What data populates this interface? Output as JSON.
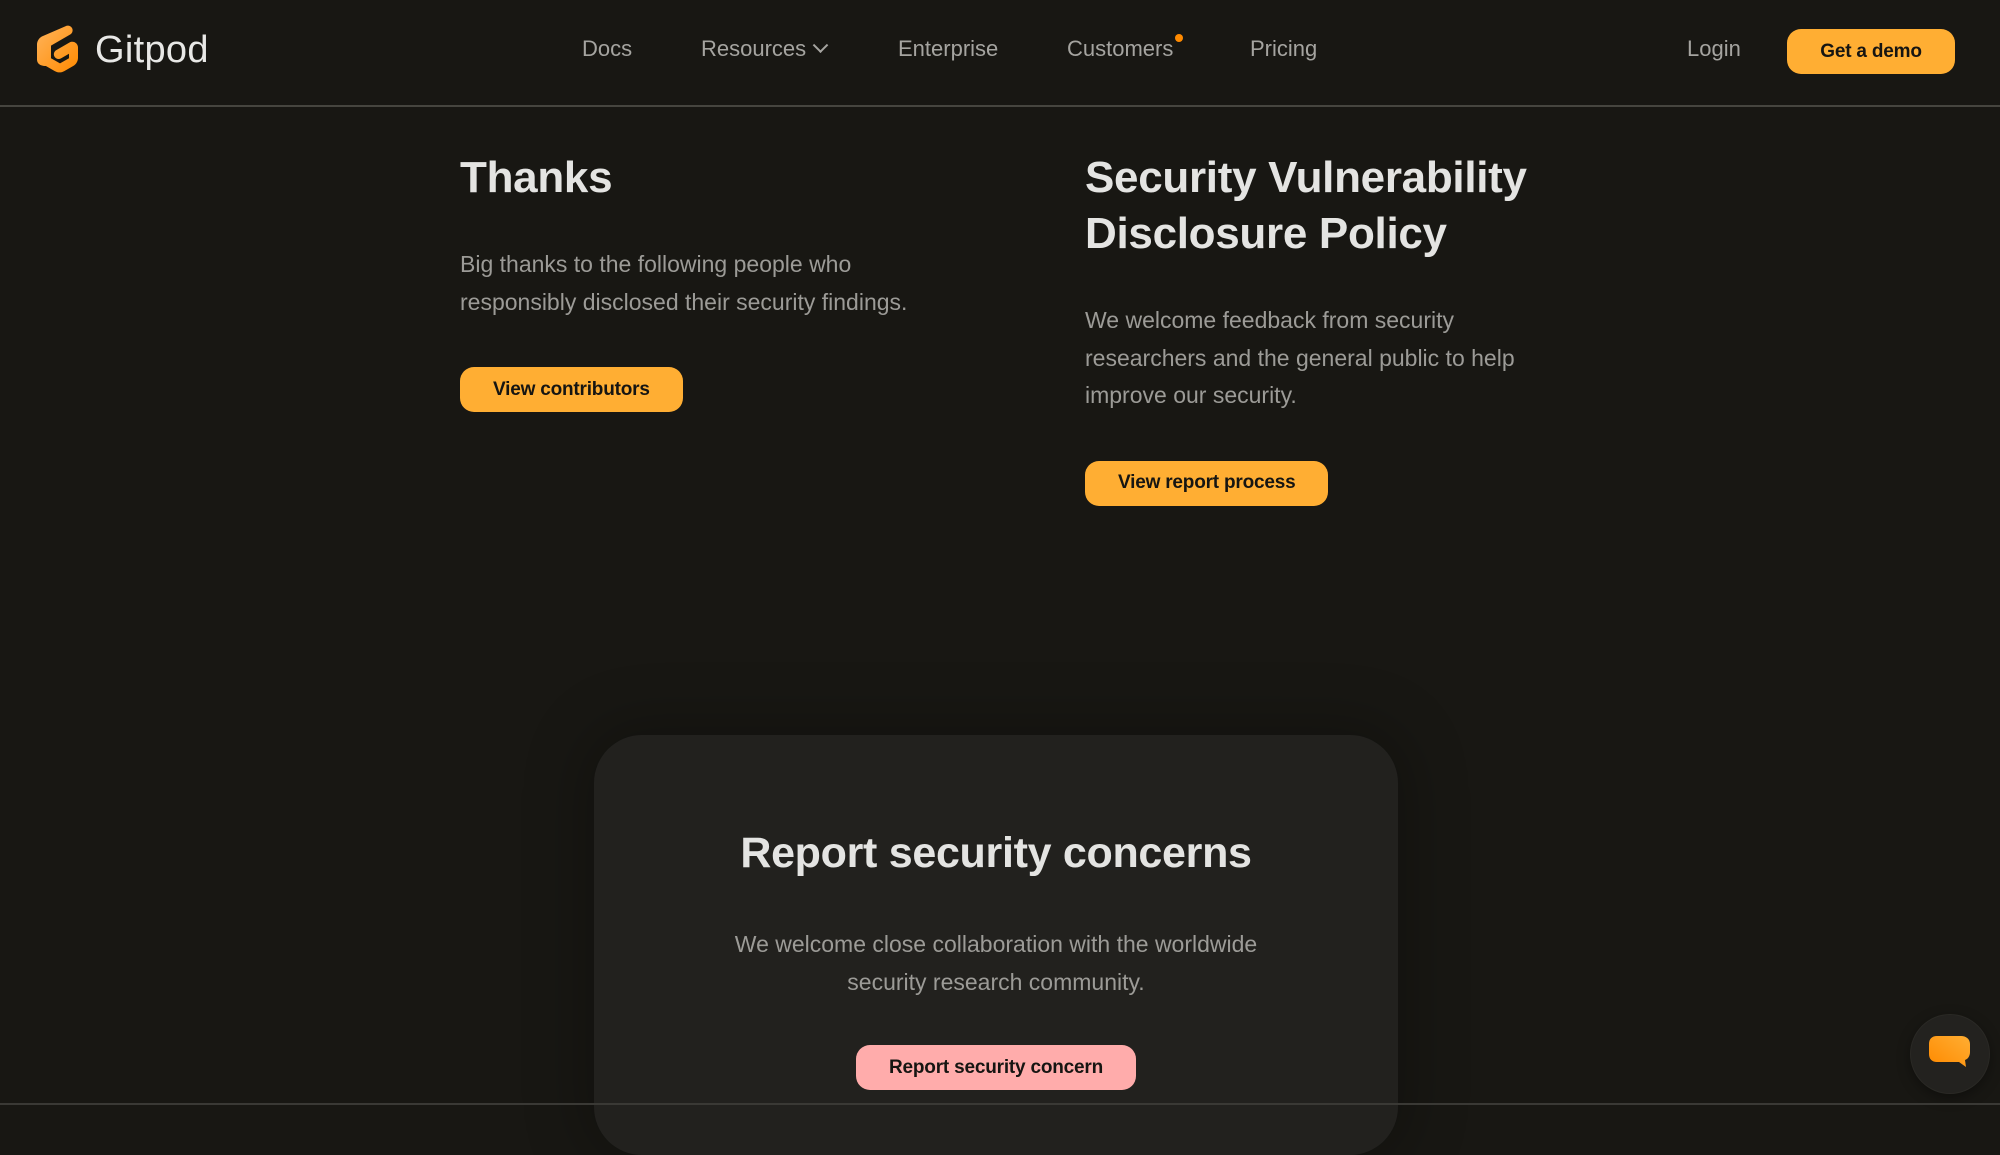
{
  "brand": {
    "name": "Gitpod",
    "accent_color": "#ffae33",
    "logo_icon": "gitpod-logo-icon"
  },
  "nav": {
    "items": [
      {
        "label": "Docs",
        "has_dropdown": false,
        "has_badge": false
      },
      {
        "label": "Resources",
        "has_dropdown": true,
        "has_badge": false
      },
      {
        "label": "Enterprise",
        "has_dropdown": false,
        "has_badge": false
      },
      {
        "label": "Customers",
        "has_dropdown": false,
        "has_badge": true
      },
      {
        "label": "Pricing",
        "has_dropdown": false,
        "has_badge": false
      }
    ],
    "badge_color": "#ff8a00",
    "login_label": "Login",
    "demo_label": "Get a demo"
  },
  "thanks": {
    "title": "Thanks",
    "body": "Big thanks to the following people who responsibly disclosed their security findings.",
    "button_label": "View contributors"
  },
  "policy": {
    "title": "Security Vulnerability Disclosure Policy",
    "body": "We welcome feedback from security researchers and the general public to help improve our security.",
    "button_label": "View report process"
  },
  "report": {
    "title": "Report security concerns",
    "body": "We welcome close collaboration with the worldwide security research community.",
    "button_label": "Report security concern",
    "button_color": "#ffacab"
  },
  "chat_widget": {
    "icon": "chat-bubble-icon"
  }
}
